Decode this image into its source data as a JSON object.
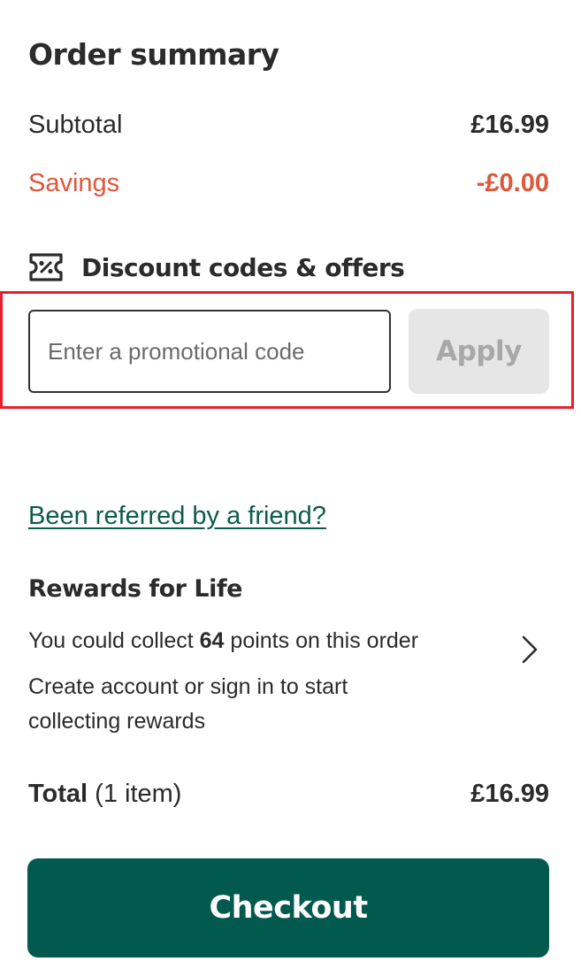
{
  "order_summary": {
    "title": "Order summary",
    "subtotal_label": "Subtotal",
    "subtotal_value": "£16.99",
    "savings_label": "Savings",
    "savings_value": "-£0.00",
    "savings_color": "#e0563b"
  },
  "discount": {
    "icon": "discount-ticket-icon",
    "title": "Discount codes & offers",
    "input_value": "",
    "input_placeholder": "Enter a promotional code",
    "apply_label": "Apply",
    "highlight_color": "#e5202c"
  },
  "referral": {
    "link_label": "Been referred by a friend?",
    "link_color": "#0b5c4b"
  },
  "rewards": {
    "title": "Rewards for Life",
    "collect_prefix": "You could collect ",
    "points": "64",
    "collect_suffix": " points on this order",
    "signin_text": "Create account or sign in to start collecting rewards",
    "icon": "chevron-right-icon"
  },
  "total": {
    "label": "Total",
    "items": " (1 item)",
    "value": "£16.99"
  },
  "checkout": {
    "label": "Checkout",
    "color": "#02594d"
  }
}
